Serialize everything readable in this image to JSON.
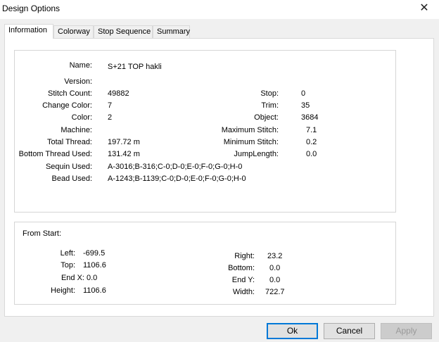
{
  "window": {
    "title": "Design Options",
    "close_symbol": "✕"
  },
  "tabs": [
    {
      "label": "Information",
      "active": true
    },
    {
      "label": "Colorway"
    },
    {
      "label": "Stop Sequence"
    },
    {
      "label": "Summary"
    }
  ],
  "info": {
    "left": [
      {
        "label": "Name:",
        "value": "S+21 TOP hakli"
      },
      {
        "label": "Version:",
        "value": ""
      },
      {
        "label": "Stitch Count:",
        "value": "49882"
      },
      {
        "label": "Change Color:",
        "value": "7"
      },
      {
        "label": "Color:",
        "value": "2"
      },
      {
        "label": "Machine:",
        "value": ""
      },
      {
        "label": "Total Thread:",
        "value": "197.72 m"
      },
      {
        "label": "Bottom Thread Used:",
        "value": "131.42 m"
      },
      {
        "label": "Sequin Used:",
        "value": "A-3016;B-316;C-0;D-0;E-0;F-0;G-0;H-0"
      },
      {
        "label": "Bead Used:",
        "value": "A-1243;B-1139;C-0;D-0;E-0;F-0;G-0;H-0"
      }
    ],
    "right": [
      {
        "label": "Stop:",
        "value": "0"
      },
      {
        "label": "Trim:",
        "value": "35"
      },
      {
        "label": "Object:",
        "value": "3684"
      },
      {
        "label": "Maximum Stitch:",
        "value": "7.1"
      },
      {
        "label": "Minimum Stitch:",
        "value": "0.2"
      },
      {
        "label": "JumpLength:",
        "value": "0.0"
      }
    ]
  },
  "from_start": {
    "heading": "From Start:",
    "left": [
      {
        "label": "Left:",
        "value": "-699.5"
      },
      {
        "label": "Top:",
        "value": "1106.6"
      },
      {
        "label": "End X:",
        "value": "0.0"
      },
      {
        "label": "Height:",
        "value": "1106.6"
      }
    ],
    "right": [
      {
        "label": "Right:",
        "value": "23.2"
      },
      {
        "label": "Bottom:",
        "value": "0.0"
      },
      {
        "label": "End Y:",
        "value": "0.0"
      },
      {
        "label": "Width:",
        "value": "722.7"
      }
    ]
  },
  "buttons": {
    "ok": "Ok",
    "cancel": "Cancel",
    "apply": "Apply"
  }
}
